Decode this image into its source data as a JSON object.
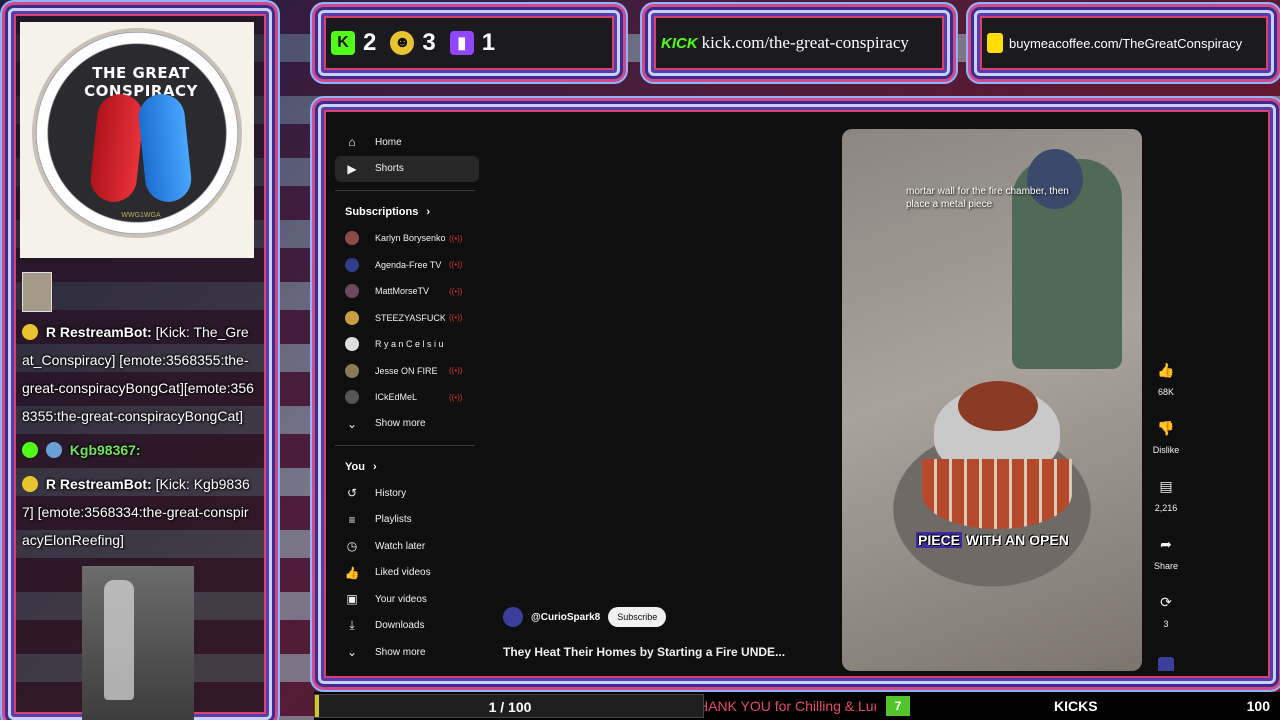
{
  "overlay": {
    "logo": {
      "title": "THE GREAT CONSPIRACY",
      "subtitle": "WWG1WGA"
    },
    "stats": [
      {
        "icon": "kick-icon",
        "glyph": "K",
        "value": "2"
      },
      {
        "icon": "rumble-icon",
        "glyph": "☻",
        "value": "3"
      },
      {
        "icon": "twitch-icon",
        "glyph": "▮",
        "value": "1"
      }
    ],
    "kick_link": {
      "logo": "KICK",
      "url": "kick.com/the-great-conspiracy"
    },
    "bmac_link": {
      "url": "buymeacoffee.com/TheGreatConspiracy"
    },
    "chat": [
      {
        "user": "R RestreamBot:",
        "text": "[Kick: The_Great_Conspiracy] [emote:3568355:the-great-conspiracyBongCat][emote:3568355:the-great-conspiracyBongCat]"
      },
      {
        "user": "Kgb98367:",
        "text": ""
      },
      {
        "user": "R RestreamBot:",
        "text": "[Kick: Kgb98367] [emote:3568334:the-great-conspiracyElonReefing]"
      }
    ],
    "bottom": {
      "progress_label": "1 / 100",
      "progress_fraction": 0.01,
      "ticker": "HANK YOU for Chilling & Lurking!",
      "kick_count": "7",
      "kick_label": "KICKS",
      "kick_goal": "100"
    },
    "colors": {
      "kick_green": "#53fc18",
      "twitch_purple": "#9146ff",
      "accent_pink": "#cf4a86"
    }
  },
  "youtube": {
    "nav": [
      {
        "label": "Home",
        "icon": "home-icon",
        "glyph": "⌂"
      },
      {
        "label": "Shorts",
        "icon": "shorts-icon",
        "glyph": "▶"
      }
    ],
    "subscriptions_header": "Subscriptions",
    "subscriptions": [
      {
        "label": "Karlyn Borysenko"
      },
      {
        "label": "Agenda-Free TV"
      },
      {
        "label": "MattMorseTV"
      },
      {
        "label": "STEEZYASFUCK"
      },
      {
        "label": "R y a n C e l s i u ..."
      },
      {
        "label": "Jesse ON FIRE"
      },
      {
        "label": "ICkEdMeL"
      }
    ],
    "show_more": "Show more",
    "you_header": "You",
    "you_items": [
      {
        "label": "History",
        "icon": "history-icon",
        "glyph": "↺"
      },
      {
        "label": "Playlists",
        "icon": "playlists-icon",
        "glyph": "≡"
      },
      {
        "label": "Watch later",
        "icon": "clock-icon",
        "glyph": "◷"
      },
      {
        "label": "Liked videos",
        "icon": "thumbs-up-icon",
        "glyph": "👍"
      },
      {
        "label": "Your videos",
        "icon": "video-icon",
        "glyph": "▣"
      },
      {
        "label": "Downloads",
        "icon": "download-icon",
        "glyph": "⤓"
      }
    ],
    "show_more_2": "Show more",
    "channel": "@CurioSpark8",
    "subscribe": "Subscribe",
    "video_title": "They Heat Their Homes by Starting a Fire UNDE...",
    "caption_top": "mortar wall for the fire chamber, then place a metal piece",
    "caption_bottom_hl": "PIECE",
    "caption_bottom_rest": " WITH AN OPEN",
    "actions": [
      {
        "label": "68K",
        "icon": "like-icon",
        "glyph": "👍"
      },
      {
        "label": "Dislike",
        "icon": "dislike-icon",
        "glyph": "👎"
      },
      {
        "label": "2,216",
        "icon": "comment-icon",
        "glyph": "▤"
      },
      {
        "label": "Share",
        "icon": "share-icon",
        "glyph": "➦"
      },
      {
        "label": "3",
        "icon": "remix-icon",
        "glyph": "⟳"
      }
    ]
  }
}
